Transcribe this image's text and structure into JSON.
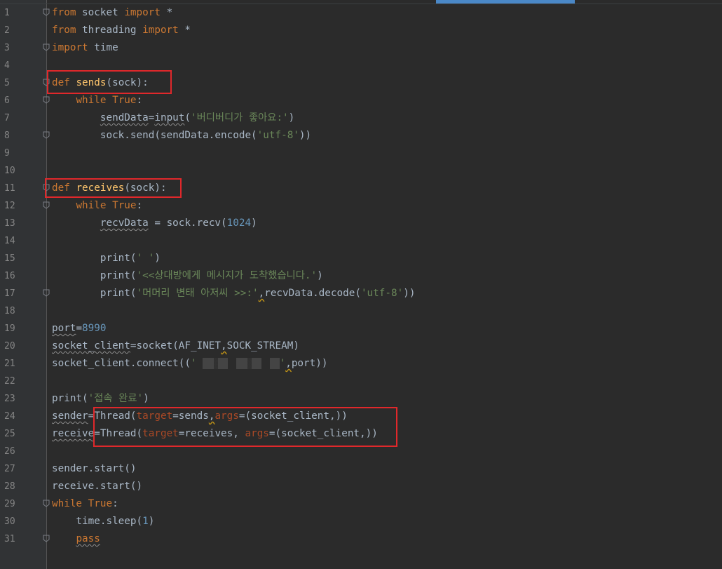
{
  "editor": {
    "language": "python",
    "colors": {
      "background": "#2b2b2b",
      "gutter": "#313335",
      "keyword": "#cc7832",
      "string": "#6a8759",
      "number": "#6897bb",
      "function": "#ffc66d",
      "parameter": "#aa4926",
      "text": "#a9b7c6",
      "highlight_box": "#e0282b"
    },
    "lines": [
      {
        "n": "1",
        "fold": true,
        "tokens": [
          [
            "kw",
            "from"
          ],
          [
            "t",
            " socket "
          ],
          [
            "kw",
            "import"
          ],
          [
            "t",
            " *"
          ]
        ]
      },
      {
        "n": "2",
        "fold": false,
        "tokens": [
          [
            "kw",
            "from"
          ],
          [
            "t",
            " threading "
          ],
          [
            "kw",
            "import"
          ],
          [
            "t",
            " *"
          ]
        ]
      },
      {
        "n": "3",
        "fold": true,
        "tokens": [
          [
            "kw",
            "import"
          ],
          [
            "t",
            " time"
          ]
        ]
      },
      {
        "n": "4",
        "fold": false,
        "tokens": []
      },
      {
        "n": "5",
        "fold": true,
        "tokens": [
          [
            "kw",
            "def"
          ],
          [
            "t",
            " "
          ],
          [
            "fn",
            "sends"
          ],
          [
            "t",
            "(sock):"
          ]
        ]
      },
      {
        "n": "6",
        "fold": true,
        "tokens": [
          [
            "t",
            "    "
          ],
          [
            "kw",
            "while"
          ],
          [
            "t",
            " "
          ],
          [
            "kw",
            "True"
          ],
          [
            "t",
            ":"
          ]
        ]
      },
      {
        "n": "7",
        "fold": false,
        "tokens": [
          [
            "t",
            "        "
          ],
          [
            "wavy",
            "sendData"
          ],
          [
            "t",
            "="
          ],
          [
            "wavy",
            "input"
          ],
          [
            "t",
            "("
          ],
          [
            "str",
            "'버디버디가 좋아요:'"
          ],
          [
            "t",
            ")"
          ]
        ]
      },
      {
        "n": "8",
        "fold": true,
        "tokens": [
          [
            "t",
            "        sock.send(sendData.encode("
          ],
          [
            "str",
            "'utf-8'"
          ],
          [
            "t",
            "))"
          ]
        ]
      },
      {
        "n": "9",
        "fold": false,
        "tokens": []
      },
      {
        "n": "10",
        "fold": false,
        "tokens": []
      },
      {
        "n": "11",
        "fold": true,
        "tokens": [
          [
            "kw",
            "def"
          ],
          [
            "t",
            " "
          ],
          [
            "fn",
            "receives"
          ],
          [
            "t",
            "(sock):"
          ]
        ]
      },
      {
        "n": "12",
        "fold": true,
        "tokens": [
          [
            "t",
            "    "
          ],
          [
            "kw",
            "while"
          ],
          [
            "t",
            " "
          ],
          [
            "kw",
            "True"
          ],
          [
            "t",
            ":"
          ]
        ]
      },
      {
        "n": "13",
        "fold": false,
        "tokens": [
          [
            "t",
            "        "
          ],
          [
            "wavy",
            "recvData"
          ],
          [
            "t",
            " = sock.recv("
          ],
          [
            "num",
            "1024"
          ],
          [
            "t",
            ")"
          ]
        ]
      },
      {
        "n": "14",
        "fold": false,
        "tokens": []
      },
      {
        "n": "15",
        "fold": false,
        "tokens": [
          [
            "t",
            "        print("
          ],
          [
            "str",
            "' '"
          ],
          [
            "t",
            ")"
          ]
        ]
      },
      {
        "n": "16",
        "fold": false,
        "tokens": [
          [
            "t",
            "        print("
          ],
          [
            "str",
            "'<<상대방에게 메시지가 도착했습니다.'"
          ],
          [
            "t",
            ")"
          ]
        ]
      },
      {
        "n": "17",
        "fold": true,
        "tokens": [
          [
            "t",
            "        print("
          ],
          [
            "str",
            "'머머리 변태 아저씨 >>:'"
          ],
          [
            "warn",
            ","
          ],
          [
            "t",
            "recvData.decode("
          ],
          [
            "str",
            "'utf-8'"
          ],
          [
            "t",
            "))"
          ]
        ]
      },
      {
        "n": "18",
        "fold": false,
        "tokens": []
      },
      {
        "n": "19",
        "fold": false,
        "tokens": [
          [
            "wavy",
            "port"
          ],
          [
            "t",
            "="
          ],
          [
            "num",
            "8990"
          ]
        ]
      },
      {
        "n": "20",
        "fold": false,
        "tokens": [
          [
            "wavy",
            "socket_client"
          ],
          [
            "t",
            "=socket(AF_INET"
          ],
          [
            "warn",
            ","
          ],
          [
            "t",
            "SOCK_STREAM)"
          ]
        ]
      },
      {
        "n": "21",
        "fold": false,
        "tokens": [
          [
            "t",
            "socket_client.connect(("
          ],
          [
            "str",
            "'"
          ],
          [
            "redact",
            ""
          ],
          [
            "str",
            "'"
          ],
          [
            "warn",
            ","
          ],
          [
            "t",
            "port))"
          ]
        ]
      },
      {
        "n": "22",
        "fold": false,
        "tokens": []
      },
      {
        "n": "23",
        "fold": false,
        "tokens": [
          [
            "t",
            "print("
          ],
          [
            "str",
            "'접속 완료'"
          ],
          [
            "t",
            ")"
          ]
        ]
      },
      {
        "n": "24",
        "fold": false,
        "tokens": [
          [
            "wavy",
            "sender"
          ],
          [
            "t",
            "=Thread("
          ],
          [
            "param",
            "target"
          ],
          [
            "t",
            "=sends"
          ],
          [
            "warn",
            ","
          ],
          [
            "param",
            "args"
          ],
          [
            "t",
            "=(socket_client,))"
          ]
        ]
      },
      {
        "n": "25",
        "fold": false,
        "tokens": [
          [
            "wavy",
            "receive"
          ],
          [
            "t",
            "=Thread("
          ],
          [
            "param",
            "target"
          ],
          [
            "t",
            "=receives, "
          ],
          [
            "param",
            "args"
          ],
          [
            "t",
            "=(socket_client,))"
          ]
        ]
      },
      {
        "n": "26",
        "fold": false,
        "tokens": []
      },
      {
        "n": "27",
        "fold": false,
        "tokens": [
          [
            "t",
            "sender.start()"
          ]
        ]
      },
      {
        "n": "28",
        "fold": false,
        "tokens": [
          [
            "t",
            "receive.start()"
          ]
        ]
      },
      {
        "n": "29",
        "fold": true,
        "tokens": [
          [
            "kw",
            "while"
          ],
          [
            "t",
            " "
          ],
          [
            "kw",
            "True"
          ],
          [
            "t",
            ":"
          ]
        ]
      },
      {
        "n": "30",
        "fold": false,
        "tokens": [
          [
            "t",
            "    time.sleep("
          ],
          [
            "num",
            "1"
          ],
          [
            "t",
            ")"
          ]
        ]
      },
      {
        "n": "31",
        "fold": true,
        "tokens": [
          [
            "t",
            "    "
          ],
          [
            "kwwavy",
            "pass"
          ]
        ]
      }
    ]
  }
}
